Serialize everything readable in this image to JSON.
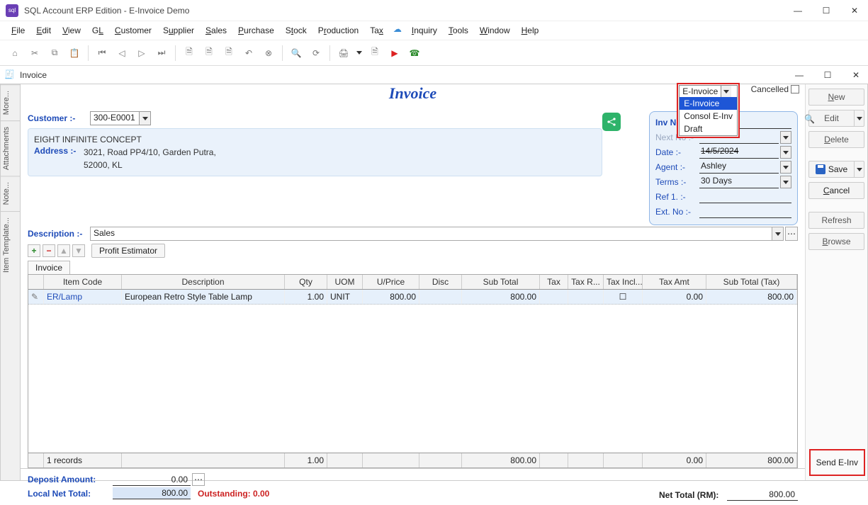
{
  "app": {
    "title": "SQL Account ERP Edition  -  E-Invoice Demo"
  },
  "menubar": [
    "File",
    "Edit",
    "View",
    "GL",
    "Customer",
    "Supplier",
    "Sales",
    "Purchase",
    "Stock",
    "Production",
    "Tax",
    "Inquiry",
    "Tools",
    "Window",
    "Help"
  ],
  "doc_window": {
    "title": "Invoice"
  },
  "side_tabs": [
    "More...",
    "Attachments",
    "Note...",
    "Item Template..."
  ],
  "header": {
    "title": "Invoice",
    "customer_label": "Customer :-",
    "customer_code": "300-E0001",
    "customer_name": "EIGHT INFINITE CONCEPT",
    "address_label": "Address :-",
    "address_line1": "3021, Road PP4/10, Garden Putra,",
    "address_line2": "52000, KL",
    "description_label": "Description :-",
    "description_value": "Sales",
    "einvoice_status": "E-Invoice",
    "einvoice_options": [
      "E-Invoice",
      "Consol E-Inv",
      "Draft"
    ],
    "cancelled_label": "Cancelled"
  },
  "meta": {
    "inv_no_label": "Inv No :",
    "next_no_label": "Next No :-",
    "date_label": "Date :-",
    "date_value": "14/5/2024",
    "agent_label": "Agent :-",
    "agent_value": "Ashley",
    "terms_label": "Terms :-",
    "terms_value": "30 Days",
    "ref1_label": "Ref 1. :-",
    "extno_label": "Ext. No :-"
  },
  "right_buttons": {
    "new": "New",
    "edit": "Edit",
    "delete": "Delete",
    "save": "Save",
    "cancel": "Cancel",
    "refresh": "Refresh",
    "browse": "Browse"
  },
  "mini_buttons": {
    "profit": "Profit Estimator"
  },
  "grid": {
    "tab": "Invoice",
    "headers": [
      "",
      "Item Code",
      "Description",
      "Qty",
      "UOM",
      "U/Price",
      "Disc",
      "Sub Total",
      "Tax",
      "Tax R...",
      "Tax Incl...",
      "Tax Amt",
      "Sub Total (Tax)"
    ],
    "rows": [
      {
        "edit": "✎",
        "item_code": "ER/Lamp",
        "description": "European Retro Style Table Lamp",
        "qty": "1.00",
        "uom": "UNIT",
        "uprice": "800.00",
        "disc": "",
        "subtotal": "800.00",
        "tax": "",
        "taxr": "",
        "taxincl": "☐",
        "taxamt": "0.00",
        "subtotal_tax": "800.00"
      }
    ],
    "footer": {
      "records": "1 records",
      "qty": "1.00",
      "subtotal": "800.00",
      "taxamt": "0.00",
      "subtotal_tax": "800.00"
    }
  },
  "bottom": {
    "deposit_label": "Deposit Amount:",
    "deposit_value": "0.00",
    "local_net_label": "Local Net Total:",
    "local_net_value": "800.00",
    "outstanding_label": "Outstanding: 0.00",
    "net_total_label": "Net Total (RM):",
    "net_total_value": "800.00",
    "send_einv": "Send E-Inv"
  }
}
